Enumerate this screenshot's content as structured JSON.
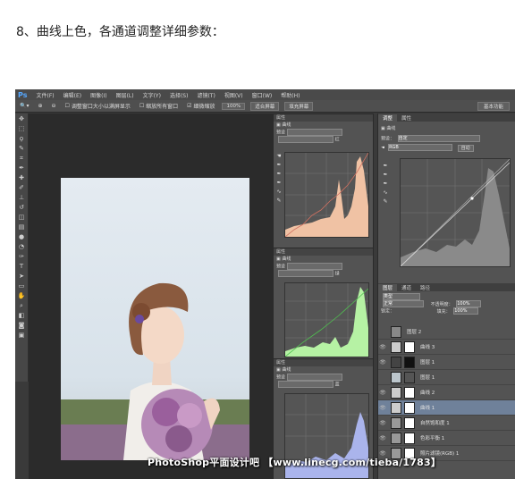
{
  "caption": "8、曲线上色，各通道调整详细参数：",
  "menubar": {
    "logo": "Ps",
    "items": [
      "文件(F)",
      "编辑(E)",
      "图像(I)",
      "图层(L)",
      "文字(Y)",
      "选择(S)",
      "滤镜(T)",
      "视图(V)",
      "窗口(W)",
      "帮助(H)"
    ]
  },
  "optbar": {
    "resize_windows": "调整窗口大小以满屏显示",
    "zoom_all": "缩放所有窗口",
    "scrubby_zoom": "细微缩放",
    "zoom_100": "100%",
    "fit_screen": "适合屏幕",
    "fill_screen": "填充屏幕",
    "workspace": "基本功能"
  },
  "curve_windows": [
    {
      "title": "属性",
      "label": "曲线",
      "preset": "预设",
      "channel": "红",
      "fill": "#f0c2a4"
    },
    {
      "title": "属性",
      "label": "曲线",
      "preset": "预设",
      "channel": "绿",
      "fill": "#b6f2a4"
    },
    {
      "title": "属性",
      "label": "曲线",
      "preset": "预设",
      "channel": "蓝",
      "fill": "#aab4ec"
    }
  ],
  "right_panel": {
    "tabs": [
      "调整",
      "属性"
    ],
    "label": "曲线",
    "preset_label": "预设：",
    "preset": "自定",
    "channel": "RGB",
    "auto": "自动"
  },
  "layers_panel": {
    "tabs": [
      "图层",
      "通道",
      "路径"
    ],
    "kind": "类型",
    "blend": "正常",
    "opacity_label": "不透明度：",
    "opacity": "100%",
    "lock_label": "锁定：",
    "fill_label": "填充：",
    "fill": "100%",
    "layers": [
      "图层 2",
      "曲线 3",
      "图层 1",
      "图层 1",
      "曲线 2",
      "曲线 1",
      "自然饱和度 1",
      "色彩平衡 1",
      "照片滤镜(RGB) 1"
    ]
  },
  "watermark": "PhotoShop平面设计吧 【www.linecg.com/tieba/1783】"
}
